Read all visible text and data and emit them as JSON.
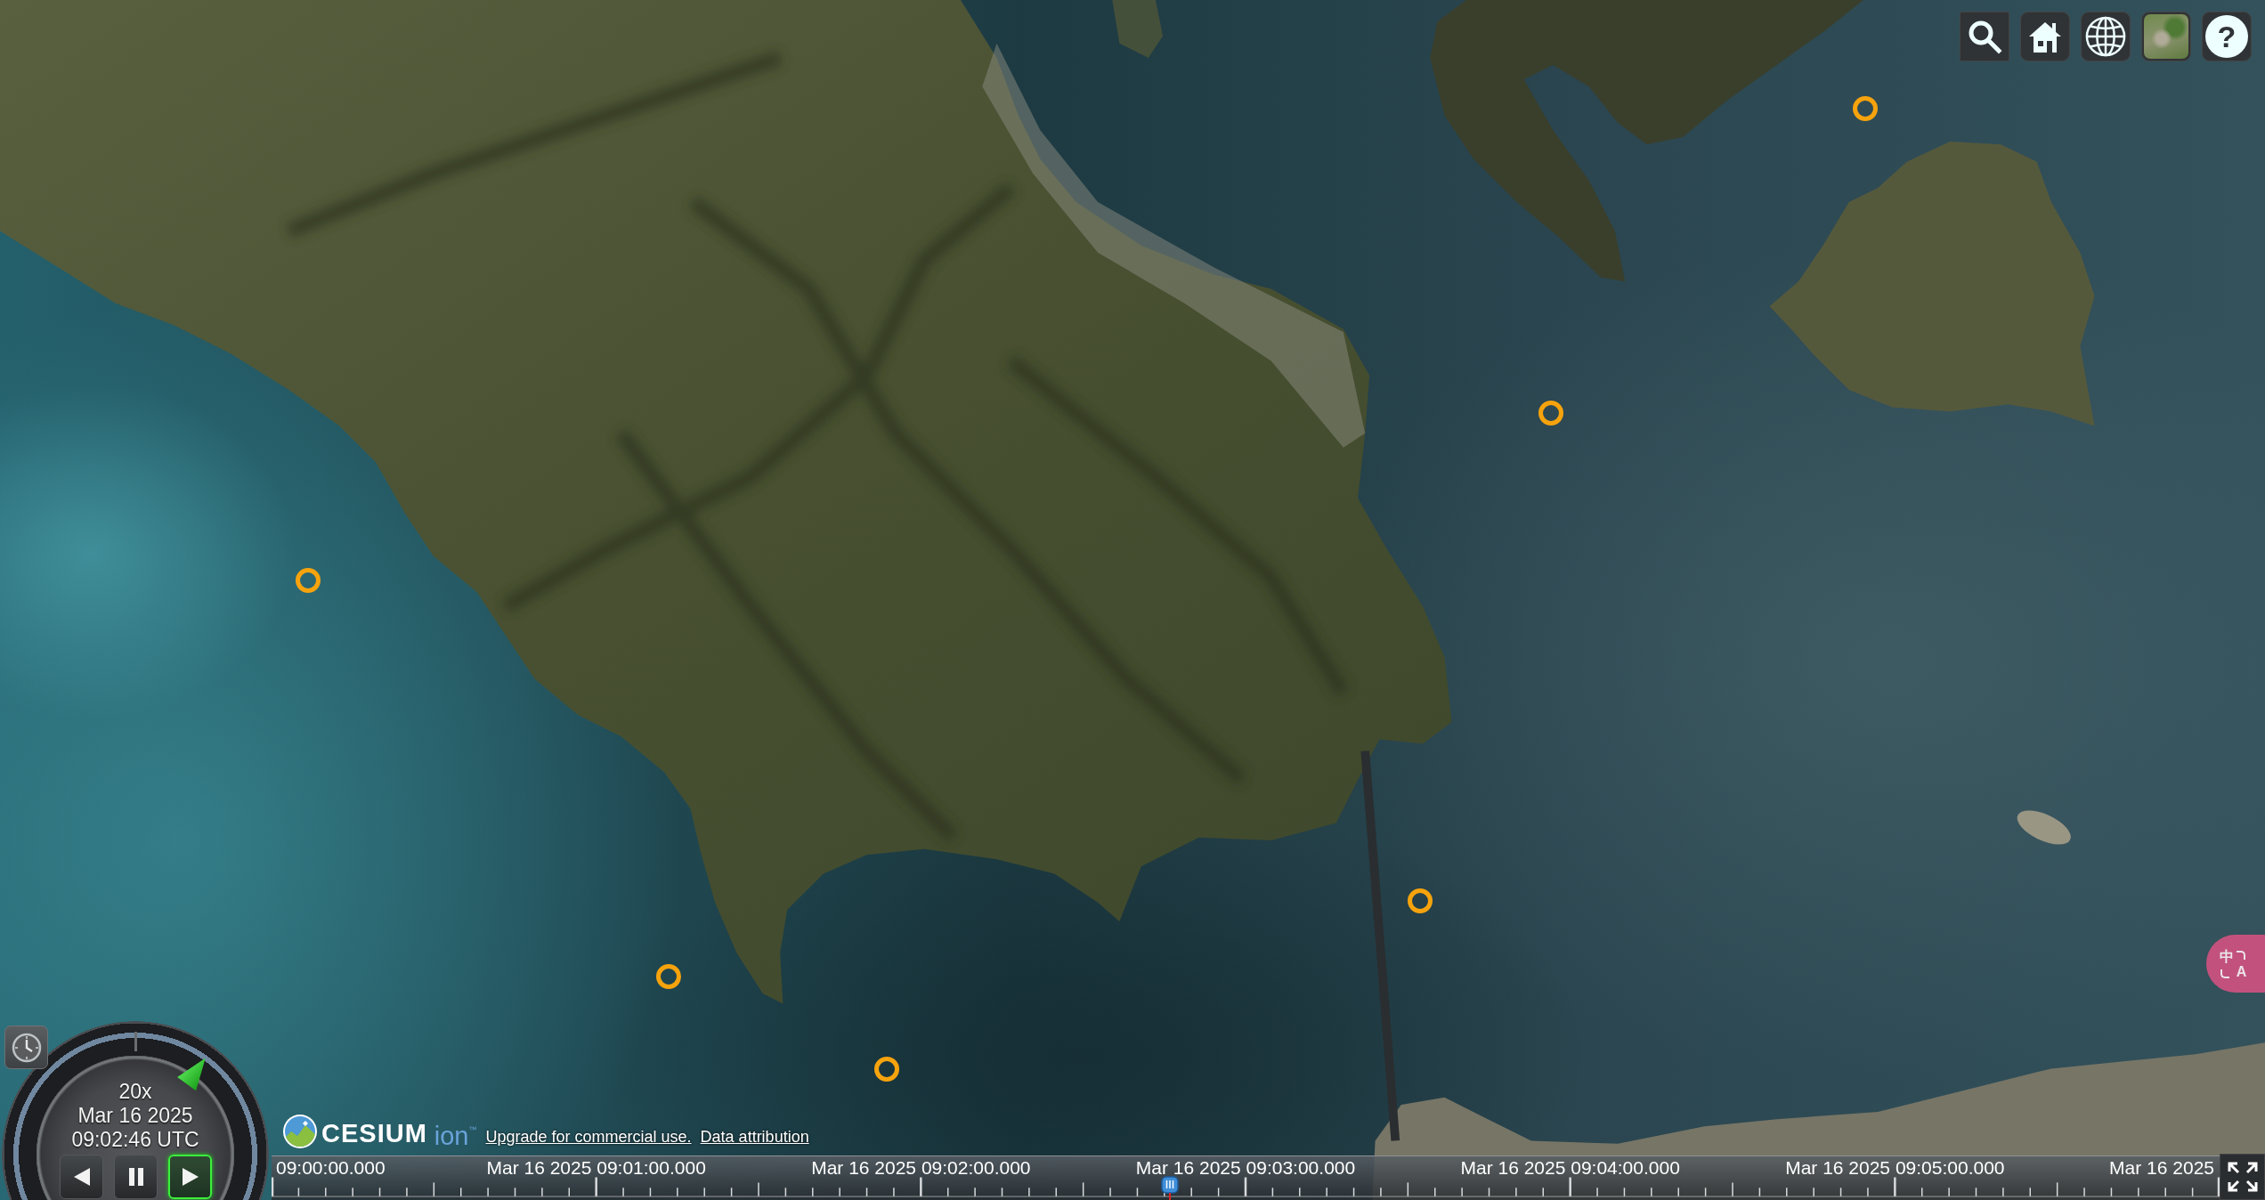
{
  "toolbar": [
    {
      "kind": "search"
    },
    {
      "kind": "home"
    },
    {
      "kind": "scene_mode"
    },
    {
      "kind": "base_layer"
    },
    {
      "kind": "help",
      "label": "?"
    }
  ],
  "animation": {
    "speed": "20x",
    "date": "Mar 16 2025",
    "time": "09:02:46 UTC",
    "buttons": [
      {
        "kind": "reverse",
        "selected": false
      },
      {
        "kind": "pause",
        "selected": false
      },
      {
        "kind": "play",
        "selected": true
      }
    ]
  },
  "credits": {
    "brand": "CESIUM",
    "product": "ion$^{™}$",
    "links": [
      "Upgrade for commercial use.",
      "Data attribution"
    ]
  },
  "timeline": {
    "labels": [
      "09:00:00.000",
      "Mar 16 2025 09:01:00.000",
      "Mar 16 2025 09:02:00.000",
      "Mar 16 2025 09:03:00.000",
      "Mar 16 2025 09:04:00.000",
      "Mar 16 2025 09:05:00.000",
      "Mar 16 2025"
    ],
    "level": 0.461
  },
  "translate_button": {
    "glyphs": [
      "中",
      "A"
    ]
  }
}
